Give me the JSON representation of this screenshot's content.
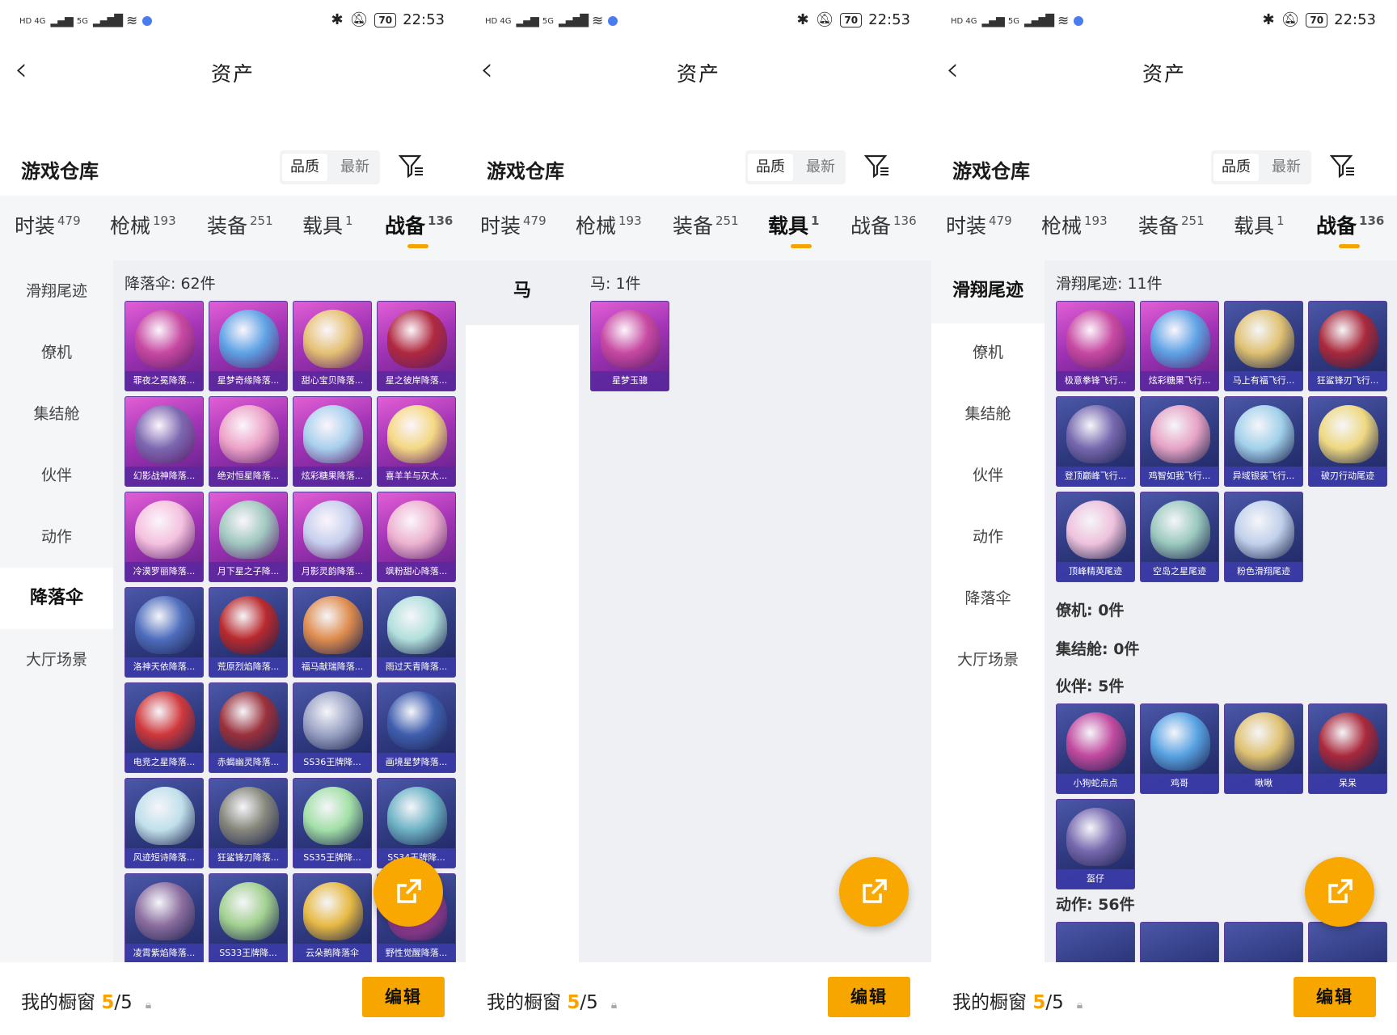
{
  "status": {
    "time": "22:53",
    "battery": "70"
  },
  "header": {
    "title": "资产"
  },
  "warehouse": {
    "title": "游戏仓库",
    "sort_quality": "品质",
    "sort_newest": "最新"
  },
  "tabs": [
    {
      "label": "时装",
      "count": "479"
    },
    {
      "label": "枪械",
      "count": "193"
    },
    {
      "label": "装备",
      "count": "251"
    },
    {
      "label": "载具",
      "count": "1"
    },
    {
      "label": "战备",
      "count": "136"
    }
  ],
  "showcase": {
    "label": "我的橱窗",
    "used": "5",
    "total": "/5",
    "edit": "编辑"
  },
  "screen1": {
    "side": [
      "滑翔尾迹",
      "僚机",
      "集结舱",
      "伙伴",
      "动作",
      "降落伞",
      "大厅场景"
    ],
    "section": "降落伞: 62件",
    "items": [
      "罪夜之冕降落...",
      "星梦奇缘降落...",
      "甜心宝贝降落...",
      "星之彼岸降落...",
      "幻影战神降落...",
      "绝对恒星降落...",
      "炫彩糖果降落...",
      "喜羊羊与灰太...",
      "冷漠罗丽降落...",
      "月下星之子降...",
      "月影灵韵降落...",
      "飒粉甜心降落...",
      "洛神天依降落...",
      "荒原烈焰降落...",
      "福马献瑞降落...",
      "雨过天青降落...",
      "电竞之星降落...",
      "赤蝎幽灵降落...",
      "SS36王牌降...",
      "画境星梦降落...",
      "风迹短诗降落...",
      "狂鲨锋刃降落...",
      "SS35王牌降...",
      "SS34王牌降...",
      "凌霄紫焰降落...",
      "SS33王牌降...",
      "云朵鹅降落伞",
      "野性觉醒降落..."
    ]
  },
  "screen2": {
    "side": [
      "马"
    ],
    "section": "马: 1件",
    "items": [
      "星梦玉骢"
    ]
  },
  "screen3": {
    "side": [
      "滑翔尾迹",
      "僚机",
      "集结舱",
      "伙伴",
      "动作",
      "降落伞",
      "大厅场景"
    ],
    "section1": "滑翔尾迹: 11件",
    "items1": [
      "极意拳锋飞行...",
      "炫彩糖果飞行...",
      "马上有福飞行...",
      "狂鲨锋刃飞行...",
      "登顶巅峰飞行...",
      "鸡智如我飞行...",
      "异域银装飞行...",
      "破刃行动尾迹",
      "顶峰精英尾迹",
      "空岛之星尾迹",
      "粉色滑翔尾迹"
    ],
    "section2": "僚机: 0件",
    "section3": "集结舱: 0件",
    "section4": "伙伴: 5件",
    "items4": [
      "小狗蛇点点",
      "鸡哥",
      "啾啾",
      "呆呆",
      "盔仔"
    ],
    "section5": "动作: 56件"
  }
}
